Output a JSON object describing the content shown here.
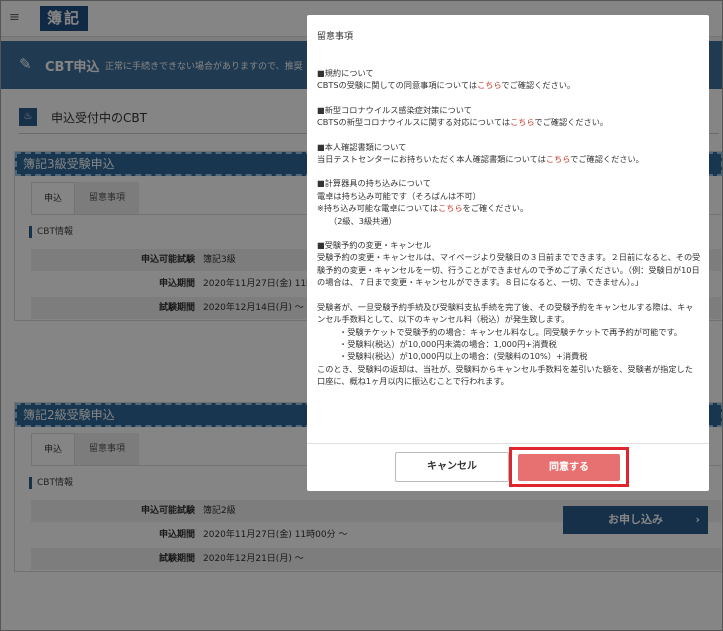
{
  "header": {
    "menu_icon": "hamburger-icon",
    "logo_text": "簿記"
  },
  "banner": {
    "title": "CBT申込",
    "note": "正常に手続きできない場合がありますので、推奨"
  },
  "section": {
    "title": "申込受付中のCBT"
  },
  "cards": [
    {
      "title": "簿記3級受験申込",
      "tab_apply": "申込",
      "tab_notes": "留意事項",
      "info_label": "CBT情報",
      "rows": [
        {
          "label": "申込可能試験",
          "value": "簿記3級"
        },
        {
          "label": "申込期間",
          "value": "2020年11月27日(金) 11時"
        },
        {
          "label": "試験期間",
          "value": "2020年12月14日(月) ～"
        }
      ]
    },
    {
      "title": "簿記2級受験申込",
      "tab_apply": "申込",
      "tab_notes": "留意事項",
      "info_label": "CBT情報",
      "rows": [
        {
          "label": "申込可能試験",
          "value": "簿記2級"
        },
        {
          "label": "申込期間",
          "value": "2020年11月27日(金) 11時00分 ～"
        },
        {
          "label": "試験期間",
          "value": "2020年12月21日(月) ～"
        }
      ]
    }
  ],
  "apply_button": "お申し込み",
  "modal": {
    "title": "留意事項",
    "s1_head": "■規約について",
    "s1_pre": "CBTSの受験に関しての同意事項については",
    "s1_link": "こちら",
    "s1_post": "でご確認ください。",
    "s2_head": "■新型コロナウイルス感染症対策について",
    "s2_pre": "CBTSの新型コロナウイルスに関する対応については",
    "s2_link": "こちら",
    "s2_post": "でご確認ください。",
    "s3_head": "■本人確認書類について",
    "s3_pre": "当日テストセンターにお持ちいただく本人確認書類については",
    "s3_link": "こちら",
    "s3_post": "でご確認ください。",
    "s4_head": "■計算器具の持ち込みについて",
    "s4_l1": "電卓は持ち込み可能です（そろばんは不可）",
    "s4_l2_pre": "※持ち込み可能な電卓については",
    "s4_l2_link": "こちら",
    "s4_l2_post": "をご確ください。",
    "s4_l3": "（2級、3級共通）",
    "s5_head": "■受験予約の変更・キャンセル",
    "s5_body": "受験予約の変更・キャンセルは、マイページより受験日の３日前までできます。２日前になると、その受験予約の変更・キャンセルを一切、行うことができませんので予めご了承ください。（例：受験日が10日の場合は、７日まで変更・キャンセルができます。８日になると、一切、できません）。」",
    "s6_body": "受験者が、一旦受験予約手続及び受験料支払手続を完了後、その受験予約をキャンセルする際は、キャンセル手数料として、以下のキャンセル料（税込）が発生致します。",
    "s6_l1": "・受験チケットで受験予約の場合：キャンセル料なし。同受験チケットで再予約が可能です。",
    "s6_l2": "・受験料(税込）が10,000円未満の場合：1,000円+消費税",
    "s6_l3": "・受験料(税込）が10,000円以上の場合：(受験料の10%）+消費税",
    "s6_tail": "このとき、受験料の返却は、当社が、受験料からキャンセル手数料を差引いた額を、受験者が指定した口座に、概ね1ヶ月以内に振込むことで行われます。",
    "cancel_label": "キャンセル",
    "agree_label": "同意する"
  },
  "colors": {
    "brand": "#2e6897",
    "agree": "#e77171",
    "highlight": "#e0252e",
    "link": "#c0392b"
  }
}
